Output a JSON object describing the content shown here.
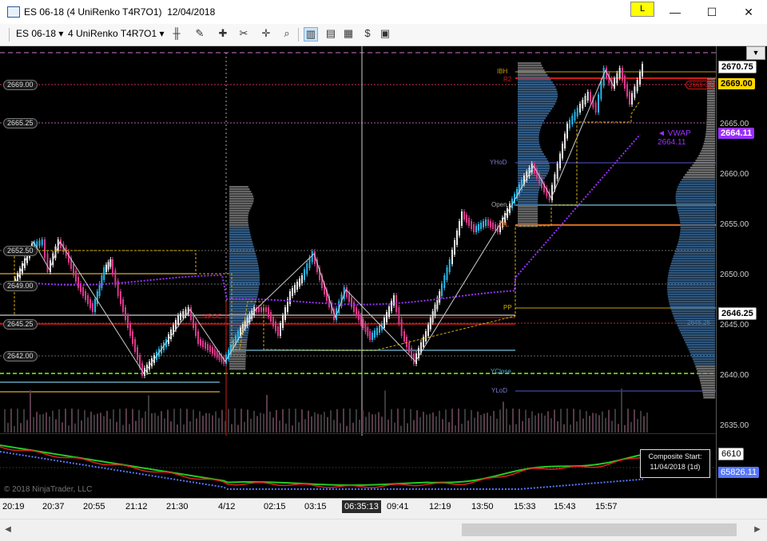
{
  "window": {
    "title": "ES 06-18 (4 UniRenko T4R7O1)  12/04/2018",
    "badge": "L",
    "minimize": "—",
    "maximize": "☐",
    "close": "✕"
  },
  "toolbar": {
    "instrument": "ES 06-18",
    "interval": "4 UniRenko T4R7O1"
  },
  "chart": {
    "copyright": "© 2018 NinjaTrader, LLC",
    "composite_line1": "Composite Start:",
    "composite_line2": "11/04/2018 (1d)",
    "left_levels": [
      "2669.00",
      "2665.25",
      "2652.50",
      "2649.00",
      "2645.25",
      "2642.00"
    ],
    "right_ticks": [
      "2670.75",
      "2665.00",
      "2660.00",
      "2655.00",
      "2650.00",
      "2645.00",
      "2640.00",
      "2635.00"
    ],
    "price_flags": {
      "last": "2670.75",
      "r2": "2669.00",
      "vwap": "2664.11",
      "pp": "2646.25"
    },
    "indicator_flags": {
      "upper": "6610",
      "lower": "65826.11"
    },
    "annotations": {
      "ibh": "IBH",
      "r2": "R2",
      "yhod": "YHoD",
      "open": "Open",
      "ibl": "IBL",
      "pp": "PP",
      "ycl": "YClose",
      "ylod": "YLoD",
      "vpoc": "VPOC",
      "vwap": "◄ VWAP  2664.11",
      "poc_right": "2669.00",
      "va_right": "2645.25"
    }
  },
  "time_labels": [
    "20:19",
    "20:37",
    "20:55",
    "21:12",
    "21:30",
    "4/12",
    "02:15",
    "03:15",
    "06:35:13",
    "09:41",
    "12:19",
    "13:50",
    "15:33",
    "15:43",
    "15:57"
  ],
  "colors": {
    "bull": "#e8e8e8",
    "bull_alt": "#29b6e8",
    "bear": "#d9388a",
    "vwap": "#9b30ff",
    "level_red": "#d11a1a",
    "level_gold": "#c8a000",
    "dashed_green": "#7cfc00",
    "price_flag_yellow": "#ffd700"
  }
}
